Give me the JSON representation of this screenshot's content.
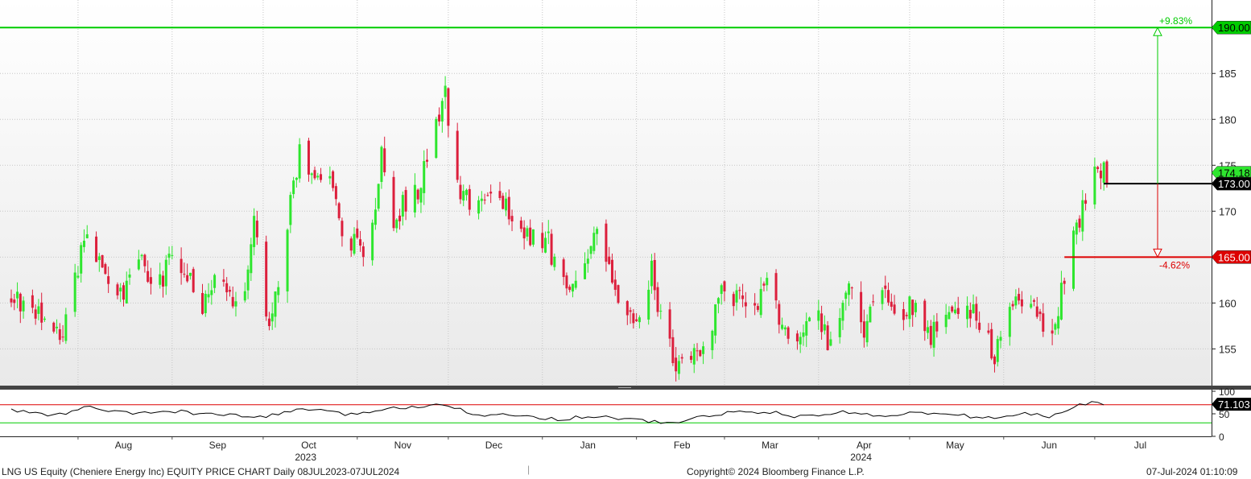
{
  "chart_data": [
    {
      "type": "candlestick",
      "ticker": "LNG US Equity",
      "x_axis": {
        "months": [
          "Aug",
          "Sep",
          "Oct",
          "Nov",
          "Dec",
          "Jan",
          "Feb",
          "Mar",
          "Apr",
          "May",
          "Jun",
          "Jul"
        ],
        "years": [
          "2023",
          "2024"
        ]
      },
      "y_axis": {
        "ticks": [
          155,
          160,
          165,
          170,
          175,
          180,
          185,
          190
        ],
        "range": [
          151,
          193
        ],
        "position": "right"
      },
      "grid": true,
      "price_path": [
        [
          "2023-07-10",
          160.5
        ],
        [
          "2023-07-20",
          158.5
        ],
        [
          "2023-07-26",
          156.0
        ],
        [
          "2023-08-01",
          164.0
        ],
        [
          "2023-08-04",
          167.5
        ],
        [
          "2023-08-10",
          162.0
        ],
        [
          "2023-08-16",
          161.0
        ],
        [
          "2023-08-22",
          164.0
        ],
        [
          "2023-08-28",
          162.0
        ],
        [
          "2023-09-01",
          165.0
        ],
        [
          "2023-09-06",
          163.5
        ],
        [
          "2023-09-11",
          160.0
        ],
        [
          "2023-09-15",
          163.5
        ],
        [
          "2023-09-20",
          160.0
        ],
        [
          "2023-09-25",
          161.0
        ],
        [
          "2023-09-28",
          168.5
        ],
        [
          "2023-10-02",
          159.0
        ],
        [
          "2023-10-04",
          158.0
        ],
        [
          "2023-10-08",
          167.0
        ],
        [
          "2023-10-13",
          176.0
        ],
        [
          "2023-10-18",
          172.5
        ],
        [
          "2023-10-24",
          173.5
        ],
        [
          "2023-10-27",
          167.0
        ],
        [
          "2023-11-01",
          166.5
        ],
        [
          "2023-11-05",
          165.0
        ],
        [
          "2023-11-09",
          176.5
        ],
        [
          "2023-11-13",
          168.5
        ],
        [
          "2023-11-16",
          171.0
        ],
        [
          "2023-11-21",
          172.0
        ],
        [
          "2023-11-25",
          178.0
        ],
        [
          "2023-11-30",
          182.5
        ],
        [
          "2023-12-02",
          175.5
        ],
        [
          "2023-12-05",
          171.5
        ],
        [
          "2023-12-10",
          170.5
        ],
        [
          "2023-12-14",
          172.5
        ],
        [
          "2023-12-18",
          171.0
        ],
        [
          "2023-12-22",
          170.0
        ],
        [
          "2023-12-28",
          167.5
        ],
        [
          "2024-01-03",
          166.5
        ],
        [
          "2024-01-06",
          163.0
        ],
        [
          "2024-01-10",
          161.0
        ],
        [
          "2024-01-15",
          165.5
        ],
        [
          "2024-01-19",
          167.0
        ],
        [
          "2024-01-24",
          162.0
        ],
        [
          "2024-01-29",
          159.0
        ],
        [
          "2024-02-03",
          157.5
        ],
        [
          "2024-02-06",
          163.5
        ],
        [
          "2024-02-10",
          157.0
        ],
        [
          "2024-02-14",
          153.0
        ],
        [
          "2024-02-19",
          154.5
        ],
        [
          "2024-02-24",
          156.0
        ],
        [
          "2024-02-29",
          161.5
        ],
        [
          "2024-03-05",
          160.5
        ],
        [
          "2024-03-11",
          160.0
        ],
        [
          "2024-03-15",
          161.5
        ],
        [
          "2024-03-20",
          158.0
        ],
        [
          "2024-03-25",
          156.5
        ],
        [
          "2024-04-01",
          158.0
        ],
        [
          "2024-04-05",
          155.0
        ],
        [
          "2024-04-11",
          161.5
        ],
        [
          "2024-04-16",
          157.5
        ],
        [
          "2024-04-22",
          161.0
        ],
        [
          "2024-04-26",
          158.5
        ],
        [
          "2024-05-01",
          160.0
        ],
        [
          "2024-05-07",
          156.5
        ],
        [
          "2024-05-12",
          157.0
        ],
        [
          "2024-05-17",
          160.0
        ],
        [
          "2024-05-23",
          158.5
        ],
        [
          "2024-05-29",
          154.5
        ],
        [
          "2024-06-03",
          160.0
        ],
        [
          "2024-06-07",
          160.5
        ],
        [
          "2024-06-12",
          159.0
        ],
        [
          "2024-06-17",
          156.0
        ],
        [
          "2024-06-21",
          163.0
        ],
        [
          "2024-06-26",
          169.0
        ],
        [
          "2024-07-01",
          174.5
        ],
        [
          "2024-07-05",
          174.0
        ]
      ],
      "last_price": 174.18,
      "levels": [
        {
          "name": "upper-target",
          "value": 190.0,
          "label": "190.00",
          "pct_label": "+9.83%",
          "color": "#00cc00"
        },
        {
          "name": "reference",
          "value": 173.0,
          "label": "173.00",
          "color": "#000000"
        },
        {
          "name": "lower-target",
          "value": 165.0,
          "label": "165.00",
          "pct_label": "-4.62%",
          "color": "#dd0000"
        }
      ],
      "last_label": "174.18",
      "colors": {
        "up": "#2ee62e",
        "down": "#dc1f3c",
        "grid": "#c6c6c6"
      }
    },
    {
      "type": "line",
      "name": "rsi",
      "y_axis": {
        "ticks": [
          0,
          50,
          100
        ],
        "range": [
          0,
          100
        ]
      },
      "overbought": 70,
      "oversold": 30,
      "last_value_label": "71.103",
      "rsi_path": [
        [
          "2023-07-10",
          58
        ],
        [
          "2023-07-25",
          46
        ],
        [
          "2023-08-04",
          65
        ],
        [
          "2023-08-18",
          50
        ],
        [
          "2023-09-01",
          56
        ],
        [
          "2023-09-15",
          48
        ],
        [
          "2023-10-01",
          42
        ],
        [
          "2023-10-14",
          62
        ],
        [
          "2023-10-28",
          48
        ],
        [
          "2023-11-10",
          60
        ],
        [
          "2023-11-30",
          73
        ],
        [
          "2023-12-10",
          48
        ],
        [
          "2023-12-28",
          45
        ],
        [
          "2024-01-06",
          38
        ],
        [
          "2024-01-18",
          45
        ],
        [
          "2024-01-30",
          38
        ],
        [
          "2024-02-12",
          28
        ],
        [
          "2024-02-20",
          40
        ],
        [
          "2024-03-01",
          52
        ],
        [
          "2024-03-15",
          55
        ],
        [
          "2024-03-27",
          42
        ],
        [
          "2024-04-10",
          55
        ],
        [
          "2024-04-20",
          45
        ],
        [
          "2024-05-01",
          52
        ],
        [
          "2024-05-15",
          48
        ],
        [
          "2024-05-29",
          40
        ],
        [
          "2024-06-08",
          50
        ],
        [
          "2024-06-17",
          44
        ],
        [
          "2024-06-24",
          65
        ],
        [
          "2024-07-01",
          78
        ],
        [
          "2024-07-05",
          71
        ]
      ],
      "colors": {
        "line": "#000000",
        "overbought": "#dd0000",
        "oversold": "#00cc00"
      }
    }
  ],
  "footer": {
    "left": "LNG US Equity (Cheniere Energy Inc) EQUITY PRICE CHART  Daily 08JUL2023-07JUL2024",
    "center": "Copyright© 2024 Bloomberg Finance L.P.",
    "right": "07-Jul-2024 01:10:09"
  }
}
